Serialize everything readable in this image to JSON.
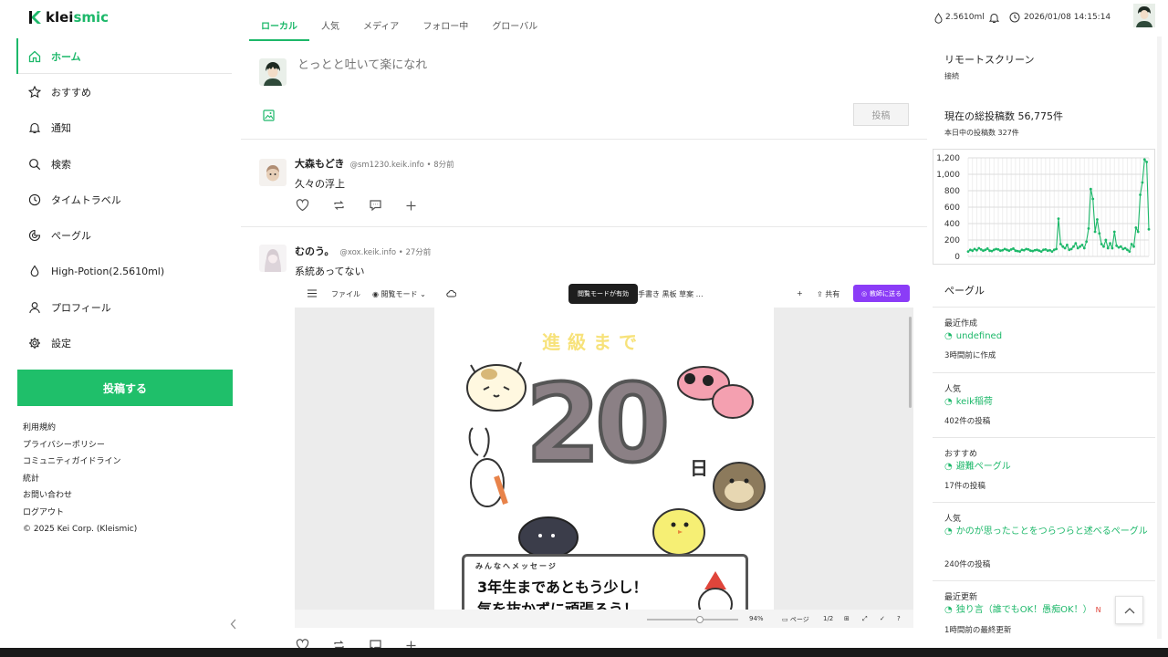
{
  "app": {
    "name": "kleismic"
  },
  "nav": {
    "items": [
      {
        "label": "ホーム",
        "icon": "home-icon"
      },
      {
        "label": "おすすめ",
        "icon": "star-icon"
      },
      {
        "label": "通知",
        "icon": "bell-icon"
      },
      {
        "label": "検索",
        "icon": "search-icon"
      },
      {
        "label": "タイムトラベル",
        "icon": "clock-icon"
      },
      {
        "label": "ぺーグル",
        "icon": "pagle-icon"
      },
      {
        "label": "High-Potion(2.5610ml)",
        "icon": "drop-icon"
      },
      {
        "label": "プロフィール",
        "icon": "user-icon"
      },
      {
        "label": "設定",
        "icon": "gear-icon"
      }
    ],
    "post_button": "投稿する"
  },
  "footer": {
    "links": [
      "利用規約",
      "プライバシーポリシー",
      "コミュニティガイドライン",
      "統計",
      "お問い合わせ",
      "ログアウト"
    ],
    "copyright": "© 2025 Kei Corp. (Kleismic)"
  },
  "tabs": [
    "ローカル",
    "人気",
    "メディア",
    "フォロー中",
    "グローバル"
  ],
  "compose": {
    "placeholder": "とっとと吐いて楽になれ",
    "submit": "投稿"
  },
  "posts": [
    {
      "name": "大森もどき",
      "handle": "@sm1230.keik.info",
      "time": "8分前",
      "body": "久々の浮上"
    },
    {
      "name": "むのう。",
      "handle": "@xox.keik.info",
      "time": "27分前",
      "body": "系統あってない"
    }
  ],
  "embed": {
    "toolbar": {
      "file": "ファイル",
      "mode": "閲覧モード",
      "tooltip": "閲覧モードが有効",
      "tools": "手書き  黒板  草案  …",
      "share": "共有",
      "send": "教師に送る"
    },
    "poster": {
      "title": "進級まで",
      "number": "20",
      "day": "日",
      "msg_label": "みんなへメッセージ",
      "msg_line1": "3年生まであともう少し！",
      "msg_line2": "気を抜かずに頑張ろう！"
    },
    "bottom": {
      "zoom": "94%",
      "page_label": "ページ",
      "page": "1/2"
    }
  },
  "topbar": {
    "potion": "2.5610ml",
    "datetime": "2026/01/08 14:15:14"
  },
  "right": {
    "remote_title": "リモートスクリーン",
    "remote_status": "接続",
    "total_posts": "現在の総投稿数 56,775件",
    "today_posts": "本日中の投稿数 327件",
    "pagle_title": "ぺーグル",
    "pagles": [
      {
        "kind": "最近作成",
        "name": "undefined",
        "sub": "3時間前に作成"
      },
      {
        "kind": "人気",
        "name": "keik稲荷",
        "sub": "402件の投稿"
      },
      {
        "kind": "おすすめ",
        "name": "避難ぺーグル",
        "sub": "17件の投稿"
      },
      {
        "kind": "人気",
        "name": "かのが思ったことをつらつらと述べるぺーグル",
        "sub": "240件の投稿"
      },
      {
        "kind": "最近更新",
        "name": "独り言（誰でもOK！愚痴OK！）",
        "sub": "1時間前の最終更新",
        "badge": "N"
      }
    ]
  },
  "colors": {
    "accent": "#1db86a",
    "send": "#8b3cf7"
  },
  "chart_data": {
    "type": "line",
    "title": "",
    "xlabel": "",
    "ylabel": "",
    "ylim": [
      0,
      1200
    ],
    "yticks": [
      "1,200",
      "1,000",
      "800",
      "600",
      "400",
      "200",
      "0"
    ],
    "grid": true,
    "series": [
      {
        "values": [
          60,
          80,
          70,
          90,
          75,
          100,
          85,
          70,
          80,
          95,
          70,
          65,
          80,
          90,
          85,
          70,
          75,
          90,
          80,
          70,
          85,
          95,
          70,
          65,
          60,
          80,
          75,
          90,
          85,
          70,
          65,
          75,
          80,
          70,
          60,
          80,
          85,
          70,
          75,
          60,
          80,
          90,
          460,
          150,
          120,
          100,
          140,
          80,
          90,
          120,
          160,
          100,
          120,
          140,
          100,
          180,
          340,
          820,
          700,
          300,
          450,
          280,
          150,
          120,
          200,
          100,
          160,
          100,
          300,
          130,
          110,
          120,
          90,
          100,
          80,
          60,
          150,
          120,
          350,
          300,
          750,
          900,
          1180,
          1150,
          330
        ]
      }
    ]
  }
}
